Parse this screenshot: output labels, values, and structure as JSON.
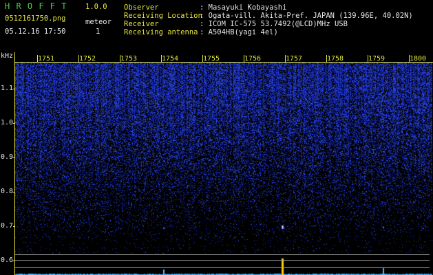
{
  "header": {
    "app_title": "H R O F F T",
    "version": "1.0.0",
    "filename": "0512161750.png",
    "meteor_label": "meteor",
    "meteor_count": "1",
    "datetime": "05.12.16 17:50",
    "info": [
      {
        "label": "Observer",
        "value": ": Masayuki Kobayashi"
      },
      {
        "label": "Receiving Location",
        "value": ": Ogata-vill. Akita-Pref. JAPAN (139.96E, 40.02N)"
      },
      {
        "label": "Receiver",
        "value": ": ICOM IC-575 53.7492(@LCD)MHz USB"
      },
      {
        "label": "Receiving antenna",
        "value": ": A504HB(yagi 4el)"
      }
    ]
  },
  "axes": {
    "y_unit": "kHz",
    "y_ticks": [
      "1.1",
      "1.0",
      "0.9",
      "0.8",
      "0.7",
      "0.6"
    ],
    "time_ticks": [
      "1751",
      "1752",
      "1753",
      "1754",
      "1755",
      "1756",
      "1757",
      "1758",
      "1759",
      "1800"
    ]
  },
  "colors": {
    "background": "#000000",
    "text_green": "#4cd04c",
    "text_yellow": "#e6e63c",
    "noise": "#3a3aff",
    "meteor": "#ffd000",
    "amplitude": "#4fb7ff"
  }
}
